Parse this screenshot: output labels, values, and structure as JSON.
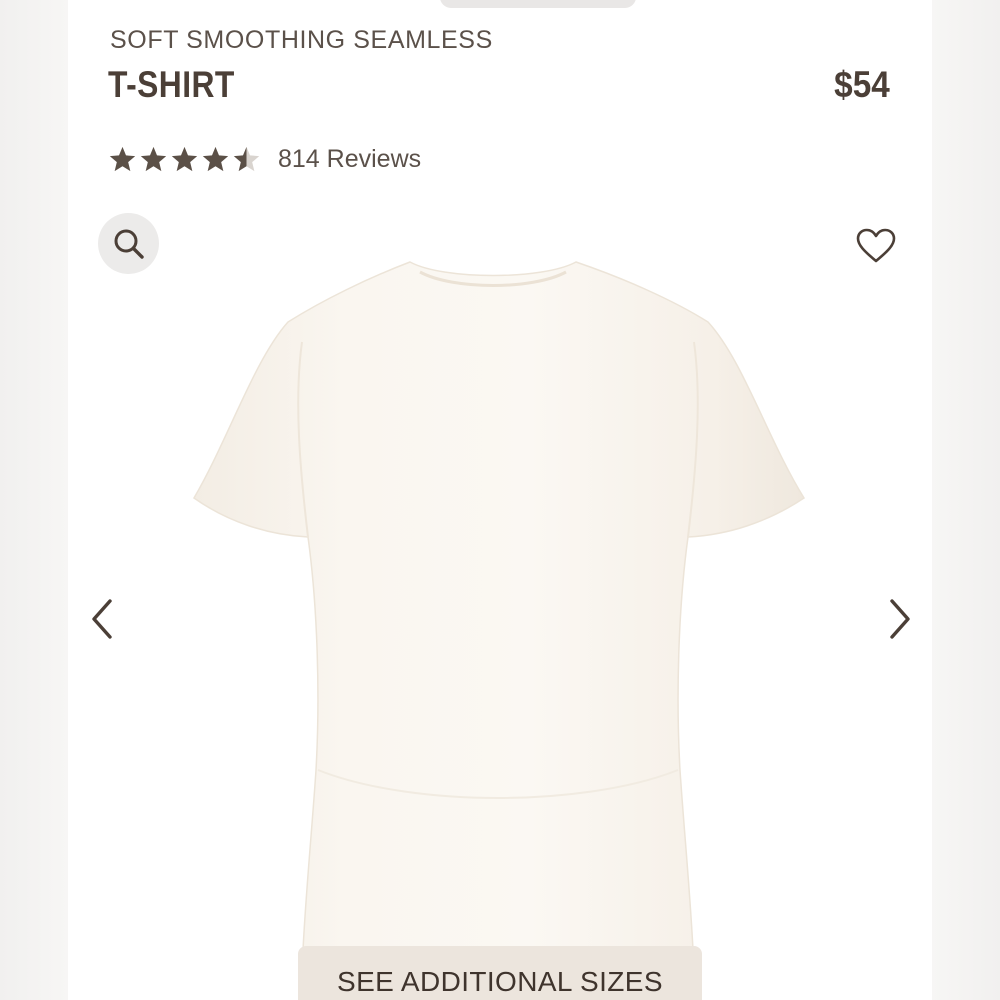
{
  "product": {
    "subtitle": "SOFT SMOOTHING SEAMLESS",
    "title": "T-SHIRT",
    "price": "$54"
  },
  "rating": {
    "value": 4.5,
    "max": 5,
    "reviews_label": "814 Reviews"
  },
  "actions": {
    "sizes_label": "SEE ADDITIONAL SIZES"
  },
  "icons": {
    "search": "search-icon",
    "favorite": "heart-icon",
    "previous": "chevron-left-icon",
    "next": "chevron-right-icon",
    "rating": "star-icon"
  },
  "colors": {
    "text_primary": "#4b3f37",
    "text_secondary": "#5b514a",
    "star": "#5b5047",
    "star_empty": "#d9d4cf",
    "garment": "#f9f5ef",
    "button_bg": "#ece5dd",
    "search_bg": "#ecebea"
  }
}
